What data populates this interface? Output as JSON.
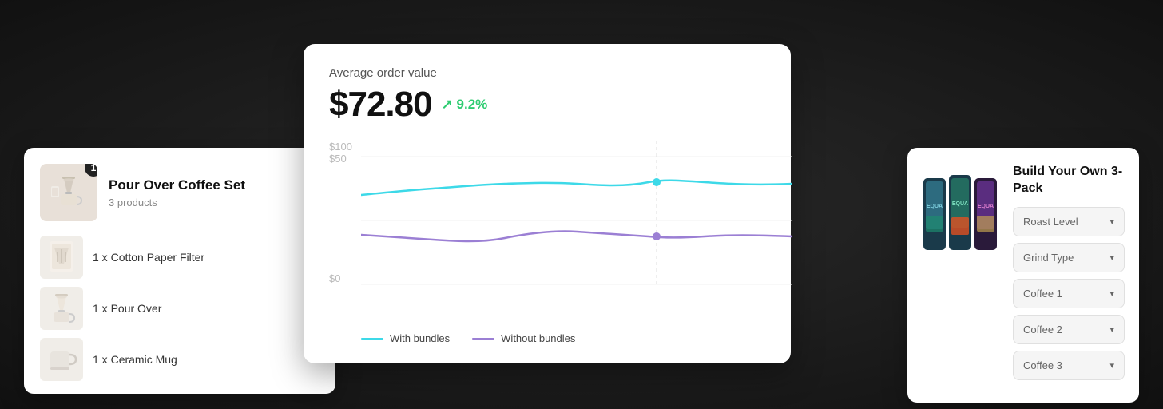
{
  "background": "#1a1a1a",
  "left_card": {
    "badge": "1",
    "title": "Pour Over Coffee Set",
    "subtitle": "3 products",
    "items": [
      {
        "qty": "1",
        "name": "Cotton Paper Filter"
      },
      {
        "qty": "1",
        "name": "Pour Over"
      },
      {
        "qty": "1",
        "name": "Ceramic Mug"
      }
    ],
    "x_label": "1 x Cotton Paper Filter",
    "y_label": "1 x Pour Over",
    "z_label": "1 x Ceramic Mug"
  },
  "center_card": {
    "title": "Average order value",
    "value": "$72.80",
    "change": "↗ 9.2%",
    "y_labels": [
      "$100",
      "$50",
      "$0"
    ],
    "legend": [
      {
        "label": "With bundles",
        "color": "#3dd9e8"
      },
      {
        "label": "Without bundles",
        "color": "#9b7fd4"
      }
    ]
  },
  "right_card": {
    "title": "Build Your Own 3-Pack",
    "dropdowns": [
      {
        "label": "Roast Level"
      },
      {
        "label": "Grind Type"
      },
      {
        "label": "Coffee 1"
      },
      {
        "label": "Coffee 2"
      },
      {
        "label": "Coffee 3"
      }
    ]
  }
}
